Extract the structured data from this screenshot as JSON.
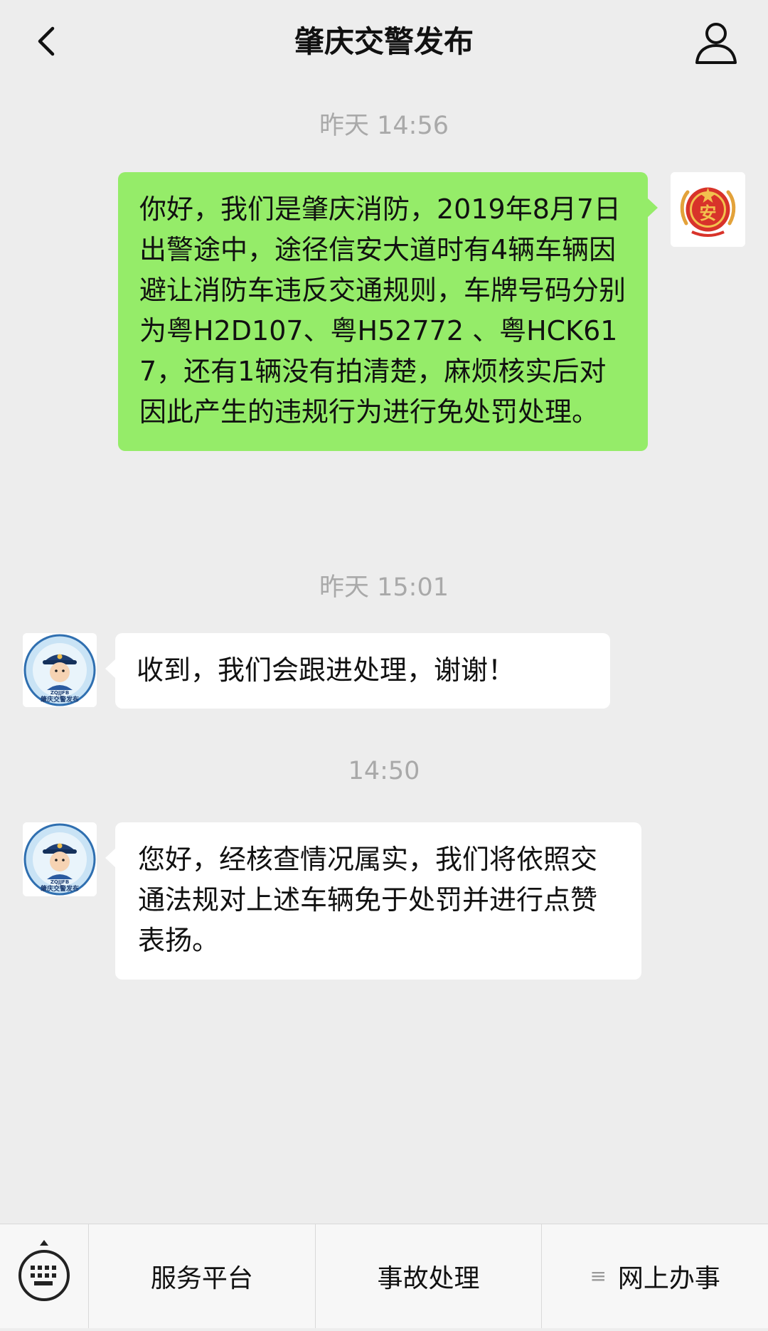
{
  "header": {
    "title": "肇庆交警发布"
  },
  "messages": [
    {
      "timestamp": "昨天 14:56",
      "sender": "user",
      "text": "你好，我们是肇庆消防，2019年8月7日出警途中，途径信安大道时有4辆车辆因避让消防车违反交通规则，车牌号码分别为粤H2D107、粤H52772 、粤HCK617，还有1辆没有拍清楚，麻烦核实后对因此产生的违规行为进行免处罚处理。"
    },
    {
      "timestamp": "昨天 15:01",
      "sender": "official",
      "text": "收到，我们会跟进处理，谢谢！"
    },
    {
      "timestamp": "14:50",
      "sender": "official",
      "text": "您好，经核查情况属实，我们将依照交通法规对上述车辆免于处罚并进行点赞表扬。"
    }
  ],
  "avatars": {
    "official_caption": "肇庆交警发布",
    "official_abbr": "ZQJJFB",
    "user_logo_glyph": "安"
  },
  "colors": {
    "background": "#ededed",
    "self_bubble": "#95ec69",
    "other_bubble": "#ffffff",
    "timestamp_text": "#a9a9a9",
    "fire_badge": "#d8332a"
  },
  "icons": {
    "back": "chevron-left-icon",
    "profile": "person-icon",
    "keyboard": "keyboard-icon",
    "submenu": "submenu-icon"
  },
  "bottom_menu": {
    "items": [
      {
        "label": "服务平台"
      },
      {
        "label": "事故处理"
      },
      {
        "label": "网上办事",
        "has_submenu_icon": true
      }
    ]
  }
}
